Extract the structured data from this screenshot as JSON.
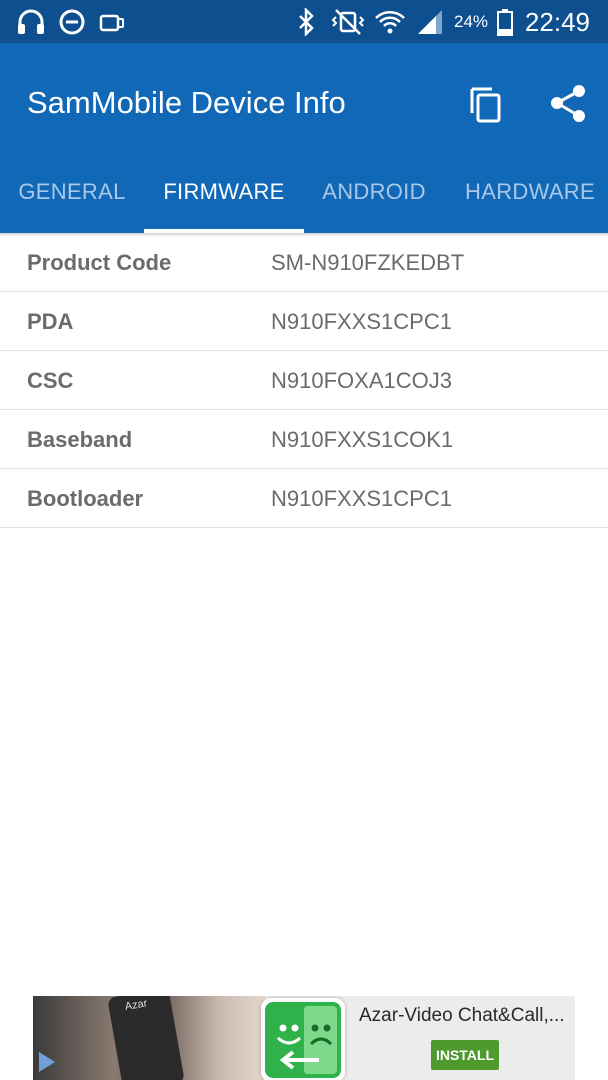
{
  "status_bar": {
    "battery_percent": "24%",
    "time": "22:49",
    "icons": [
      "headphones-icon",
      "do-not-disturb-icon",
      "cast-icon",
      "bluetooth-icon",
      "vibrate-mute-icon",
      "wifi-icon",
      "signal-icon",
      "battery-icon"
    ]
  },
  "app_bar": {
    "title": "SamMobile Device Info",
    "actions": [
      "copy-icon",
      "share-icon"
    ],
    "color": "#1068b7"
  },
  "tabs": [
    {
      "label": "GENERAL",
      "active": false
    },
    {
      "label": "FIRMWARE",
      "active": true
    },
    {
      "label": "ANDROID",
      "active": false
    },
    {
      "label": "HARDWARE",
      "active": false
    }
  ],
  "firmware_rows": [
    {
      "label": "Product Code",
      "value": "SM-N910FZKEDBT"
    },
    {
      "label": "PDA",
      "value": "N910FXXS1CPC1"
    },
    {
      "label": "CSC",
      "value": "N910FOXA1COJ3"
    },
    {
      "label": "Baseband",
      "value": "N910FXXS1COK1"
    },
    {
      "label": "Bootloader",
      "value": "N910FXXS1CPC1"
    }
  ],
  "ad": {
    "phone_brand": "Azar",
    "title": "Azar-Video Chat&Call,...",
    "install_label": "INSTALL",
    "install_color": "#4e9a2e"
  }
}
